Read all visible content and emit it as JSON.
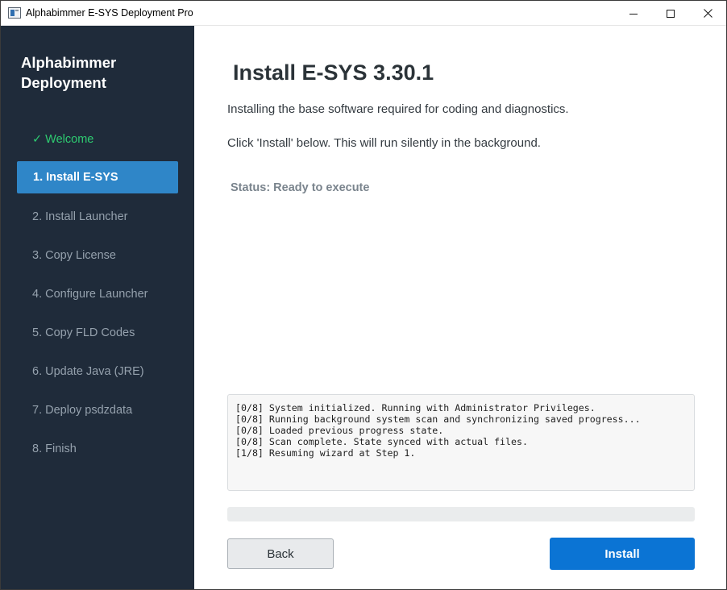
{
  "window": {
    "title": "Alphabimmer E-SYS Deployment Pro"
  },
  "sidebar": {
    "brand": "Alphabimmer Deployment",
    "items": [
      {
        "label": "✓ Welcome",
        "state": "done"
      },
      {
        "label": "1. Install E-SYS",
        "state": "active"
      },
      {
        "label": "2. Install Launcher",
        "state": "pending"
      },
      {
        "label": "3. Copy License",
        "state": "pending"
      },
      {
        "label": "4. Configure Launcher",
        "state": "pending"
      },
      {
        "label": "5. Copy FLD Codes",
        "state": "pending"
      },
      {
        "label": "6. Update Java (JRE)",
        "state": "pending"
      },
      {
        "label": "7. Deploy psdzdata",
        "state": "pending"
      },
      {
        "label": "8. Finish",
        "state": "pending"
      }
    ]
  },
  "main": {
    "title": "Install E-SYS 3.30.1",
    "description": "Installing the base software required for coding and diagnostics.",
    "instruction": "Click 'Install' below. This will run silently in the background.",
    "status": "Status: Ready to execute",
    "log": [
      "[0/8] System initialized. Running with Administrator Privileges.",
      "[0/8] Running background system scan and synchronizing saved progress...",
      "[0/8] Loaded previous progress state.",
      "[0/8] Scan complete. State synced with actual files.",
      "[1/8] Resuming wizard at Step 1."
    ],
    "progress_percent": 0,
    "back_label": "Back",
    "install_label": "Install"
  },
  "colors": {
    "sidebar_bg": "#1f2b3a",
    "active_item": "#2f86c8",
    "done_item": "#2ecc71",
    "primary_button": "#0b74d4"
  },
  "icons": {
    "app": "app-window-icon",
    "minimize": "minimize-icon",
    "maximize": "maximize-icon",
    "close": "close-icon"
  }
}
